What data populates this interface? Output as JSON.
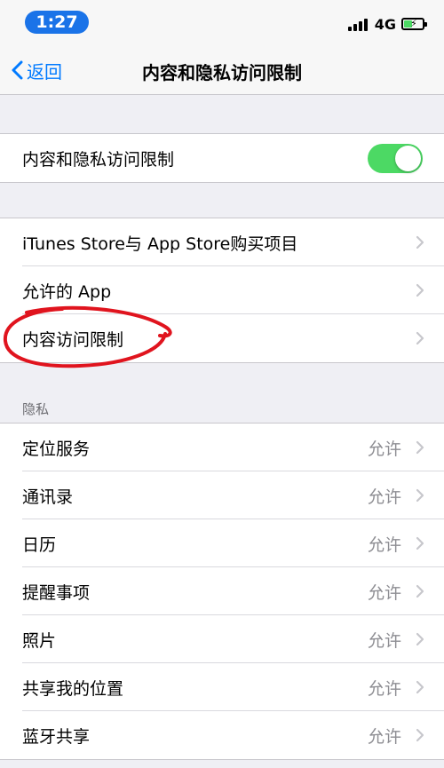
{
  "status_bar": {
    "time": "1:27",
    "network": "4G",
    "battery_color": "#4cd964"
  },
  "nav": {
    "back_label": "返回",
    "title": "内容和隐私访问限制"
  },
  "toggle_row": {
    "label": "内容和隐私访问限制",
    "enabled": true
  },
  "restrictions": [
    {
      "label": "iTunes Store与 App Store购买项目"
    },
    {
      "label": "允许的 App"
    },
    {
      "label": "内容访问限制"
    }
  ],
  "privacy": {
    "header": "隐私",
    "items": [
      {
        "label": "定位服务",
        "value": "允许"
      },
      {
        "label": "通讯录",
        "value": "允许"
      },
      {
        "label": "日历",
        "value": "允许"
      },
      {
        "label": "提醒事项",
        "value": "允许"
      },
      {
        "label": "照片",
        "value": "允许"
      },
      {
        "label": "共享我的位置",
        "value": "允许"
      },
      {
        "label": "蓝牙共享",
        "value": "允许"
      }
    ]
  },
  "colors": {
    "accent": "#007aff",
    "switch_on": "#4cd964",
    "annotation": "#e0141e",
    "time_pill": "#1a73e8"
  },
  "annotation": {
    "type": "hand-drawn red circle",
    "target": "内容访问限制"
  }
}
